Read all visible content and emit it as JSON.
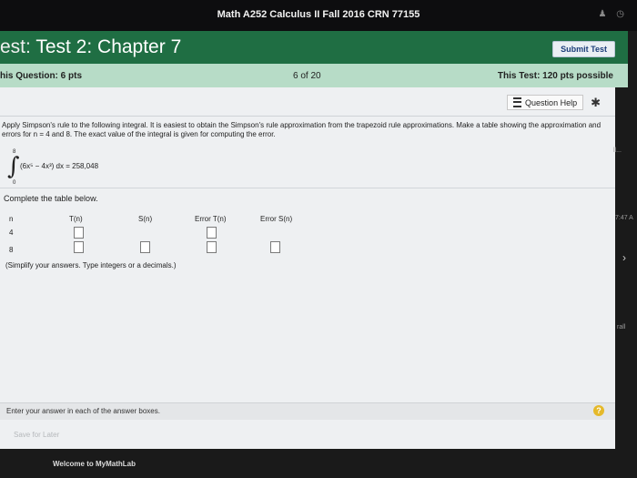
{
  "course": {
    "title": "Math A252 Calculus II Fall 2016 CRN 77155"
  },
  "header": {
    "test_prefix": "est:",
    "test_title": "Test 2: Chapter 7",
    "submit_label": "Submit Test"
  },
  "info": {
    "question_points": "his Question: 6 pts",
    "progress": "6 of 20",
    "test_points": "This Test: 120 pts possible"
  },
  "help": {
    "label": "Question Help"
  },
  "problem": {
    "instructions": "Apply Simpson's rule to the following integral. It is easiest to obtain the Simpson's rule approximation from the trapezoid rule approximations. Make a table showing the approximation and errors for n = 4 and 8. The exact value of the integral is given for computing the error.",
    "integral_upper": "8",
    "integral_lower": "0",
    "integral_expression": "(6x⁵ − 4x³) dx = 258,048",
    "complete_prompt": "Complete the table below.",
    "simplify_note": "(Simplify your answers. Type integers or a decimals.)"
  },
  "table": {
    "headers": [
      "n",
      "T(n)",
      "S(n)",
      "Error T(n)",
      "Error S(n)"
    ],
    "rows": [
      {
        "n": "4"
      },
      {
        "n": "8"
      }
    ]
  },
  "footer": {
    "hint": "Enter your answer in each of the answer boxes.",
    "save_later": "Save for Later",
    "welcome": "Welcome to MyMathLab"
  },
  "side": {
    "time_fragment": "7:47 A",
    "label_fragment": "rall",
    "ellipsis_fragment": "ll..."
  },
  "colors": {
    "header_green": "#1f6e43",
    "info_green": "#b7dcc7",
    "help_yellow": "#e5b92a"
  }
}
